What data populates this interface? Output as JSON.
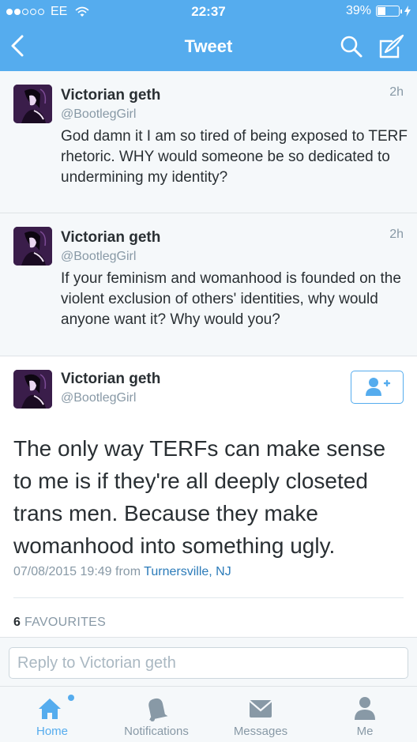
{
  "status_bar": {
    "carrier": "EE",
    "time": "22:37",
    "battery": "39%",
    "battery_level": 0.39
  },
  "nav": {
    "title": "Tweet"
  },
  "tweets": [
    {
      "name": "Victorian geth",
      "handle": "@BootlegGirl",
      "time": "2h",
      "text": "God damn it I am so tired of being exposed to TERF rhetoric. WHY would someone be so dedicated to undermining my identity?"
    },
    {
      "name": "Victorian geth",
      "handle": "@BootlegGirl",
      "time": "2h",
      "text": "If your feminism and womanhood is founded on the violent exclusion of others' identities, why would anyone want it? Why would you?"
    }
  ],
  "main": {
    "name": "Victorian geth",
    "handle": "@BootlegGirl",
    "text": "The only way TERFs can make sense to me is if they're all deeply closeted trans men. Because they make womanhood into something ugly.",
    "date": "07/08/2015 19:49",
    "from_label": "from",
    "location": "Turnersville, NJ",
    "favourites_count": "6",
    "favourites_label": "FAVOURITES"
  },
  "reply": {
    "placeholder": "Reply to Victorian geth"
  },
  "tabs": [
    {
      "label": "Home",
      "icon": "home-icon"
    },
    {
      "label": "Notifications",
      "icon": "bell-icon"
    },
    {
      "label": "Messages",
      "icon": "envelope-icon"
    },
    {
      "label": "Me",
      "icon": "person-icon"
    }
  ],
  "colors": {
    "brand": "#55acee",
    "link": "#2b7bb9",
    "muted": "#8899a6"
  }
}
